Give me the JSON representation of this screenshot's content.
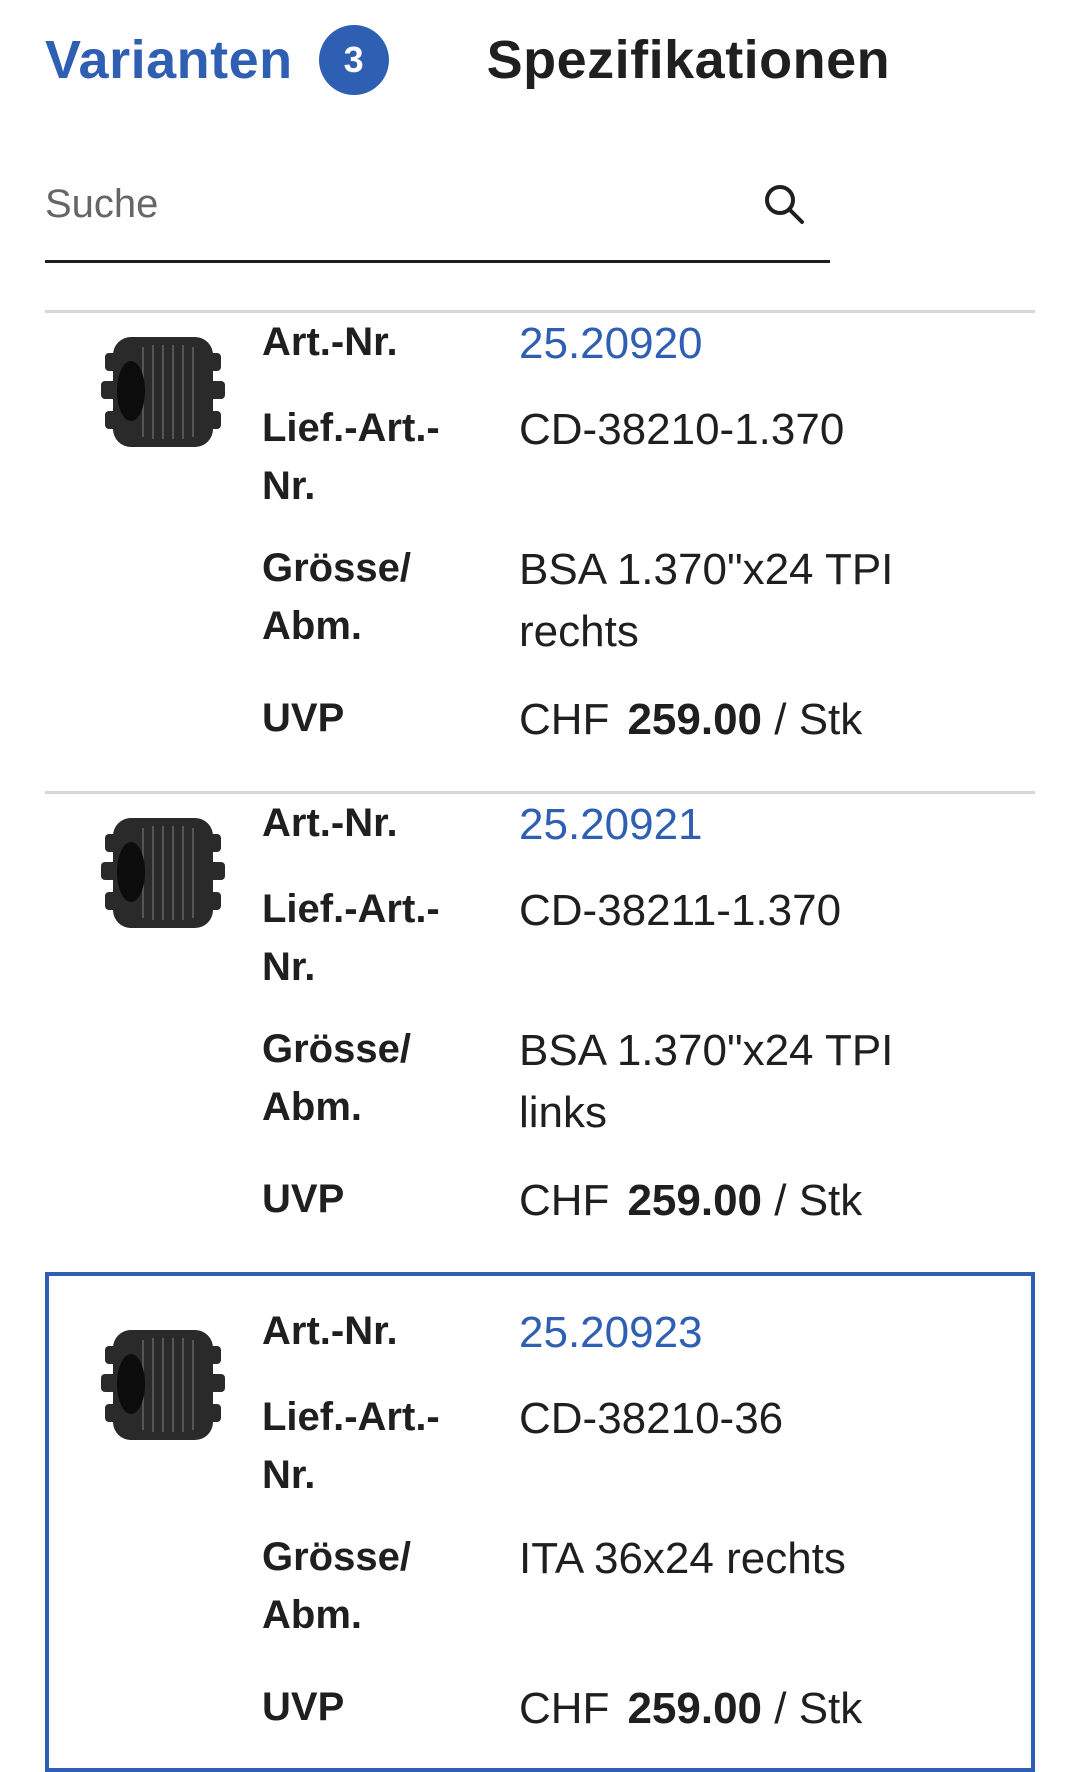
{
  "tabs": {
    "variants_label": "Varianten",
    "variants_count": "3",
    "specs_label": "Spezifikationen"
  },
  "search": {
    "placeholder": "Suche",
    "icon": "search-icon"
  },
  "colors": {
    "accent": "#2f5fb3",
    "divider": "#d6d6d6",
    "text": "#1f1f1f"
  },
  "labels": {
    "art_nr": "Art.-Nr.",
    "lief_art_nr": "Lief.-Art.-Nr.",
    "size": "Grösse/ Abm.",
    "uvp": "UVP"
  },
  "items": [
    {
      "art_nr": "25.20920",
      "lief_art_nr": "CD-38210-1.370",
      "size": "BSA 1.370\"x24 TPI rechts",
      "currency": "CHF",
      "price": "259.00",
      "unit": "/ Stk",
      "image": "cutter-icon",
      "selected": false
    },
    {
      "art_nr": "25.20921",
      "lief_art_nr": "CD-38211-1.370",
      "size": "BSA 1.370\"x24 TPI links",
      "currency": "CHF",
      "price": "259.00",
      "unit": "/ Stk",
      "image": "cutter-icon",
      "selected": false
    },
    {
      "art_nr": "25.20923",
      "lief_art_nr": "CD-38210-36",
      "size": "ITA 36x24 rechts",
      "currency": "CHF",
      "price": "259.00",
      "unit": "/ Stk",
      "image": "cutter-icon",
      "selected": true
    }
  ]
}
